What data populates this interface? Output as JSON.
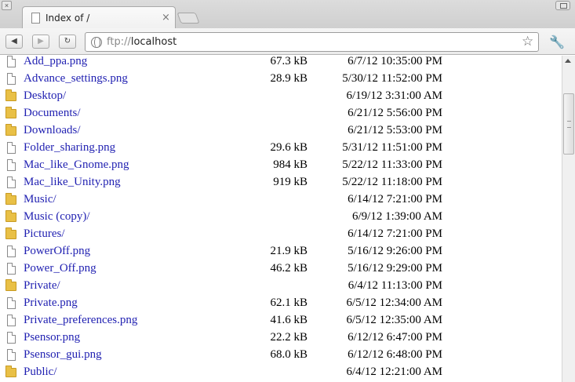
{
  "window": {
    "tab_title": "Index of /",
    "tab_close": "×",
    "corner_glyph": "×"
  },
  "toolbar": {
    "back_glyph": "◀",
    "forward_glyph": "▶",
    "reload_glyph": "↻",
    "url_scheme": "ftp://",
    "url_host": "localhost",
    "star_glyph": "☆",
    "wrench_glyph": "🔧"
  },
  "files": [
    {
      "name": "Add_ppa.png",
      "size": "67.3 kB",
      "date": "6/7/12 10:35:00 PM",
      "type": "file"
    },
    {
      "name": "Advance_settings.png",
      "size": "28.9 kB",
      "date": "5/30/12 11:52:00 PM",
      "type": "file"
    },
    {
      "name": "Desktop/",
      "size": "",
      "date": "6/19/12 3:31:00 AM",
      "type": "folder"
    },
    {
      "name": "Documents/",
      "size": "",
      "date": "6/21/12 5:56:00 PM",
      "type": "folder"
    },
    {
      "name": "Downloads/",
      "size": "",
      "date": "6/21/12 5:53:00 PM",
      "type": "folder"
    },
    {
      "name": "Folder_sharing.png",
      "size": "29.6 kB",
      "date": "5/31/12 11:51:00 PM",
      "type": "file"
    },
    {
      "name": "Mac_like_Gnome.png",
      "size": "984 kB",
      "date": "5/22/12 11:33:00 PM",
      "type": "file"
    },
    {
      "name": "Mac_like_Unity.png",
      "size": "919 kB",
      "date": "5/22/12 11:18:00 PM",
      "type": "file"
    },
    {
      "name": "Music/",
      "size": "",
      "date": "6/14/12 7:21:00 PM",
      "type": "folder"
    },
    {
      "name": "Music (copy)/",
      "size": "",
      "date": "6/9/12 1:39:00 AM",
      "type": "folder"
    },
    {
      "name": "Pictures/",
      "size": "",
      "date": "6/14/12 7:21:00 PM",
      "type": "folder"
    },
    {
      "name": "PowerOff.png",
      "size": "21.9 kB",
      "date": "5/16/12 9:26:00 PM",
      "type": "file"
    },
    {
      "name": "Power_Off.png",
      "size": "46.2 kB",
      "date": "5/16/12 9:29:00 PM",
      "type": "file"
    },
    {
      "name": "Private/",
      "size": "",
      "date": "6/4/12 11:13:00 PM",
      "type": "folder"
    },
    {
      "name": "Private.png",
      "size": "62.1 kB",
      "date": "6/5/12 12:34:00 AM",
      "type": "file"
    },
    {
      "name": "Private_preferences.png",
      "size": "41.6 kB",
      "date": "6/5/12 12:35:00 AM",
      "type": "file"
    },
    {
      "name": "Psensor.png",
      "size": "22.2 kB",
      "date": "6/12/12 6:47:00 PM",
      "type": "file"
    },
    {
      "name": "Psensor_gui.png",
      "size": "68.0 kB",
      "date": "6/12/12 6:48:00 PM",
      "type": "file"
    },
    {
      "name": "Public/",
      "size": "",
      "date": "6/4/12 12:21:00 AM",
      "type": "folder"
    }
  ]
}
